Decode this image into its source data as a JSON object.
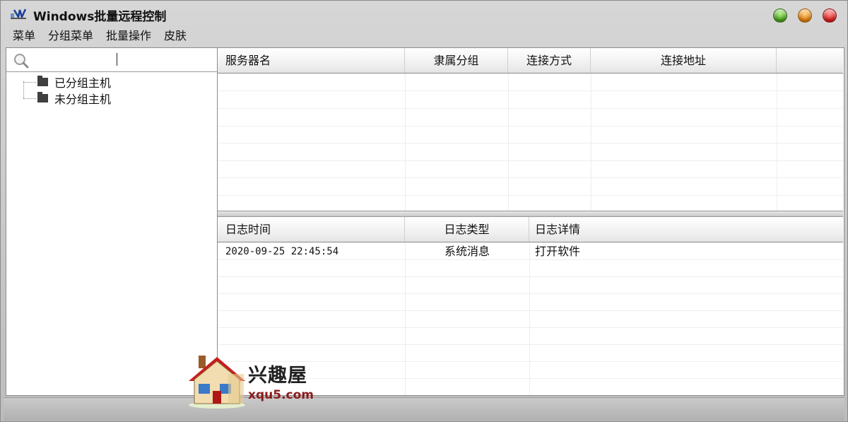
{
  "window": {
    "title": "Windows批量远程控制",
    "icon": "remote-desktop-app-icon",
    "controls": [
      "maximize-green-icon",
      "minimize-orange-icon",
      "close-red-icon"
    ]
  },
  "menu": {
    "items": [
      "菜单",
      "分组菜单",
      "批量操作",
      "皮肤"
    ]
  },
  "search": {
    "value": "",
    "icon": "search-icon"
  },
  "tree": {
    "nodes": [
      {
        "label": "已分组主机",
        "icon": "folder-icon"
      },
      {
        "label": "未分组主机",
        "icon": "folder-icon"
      }
    ]
  },
  "servers_table": {
    "columns": [
      "服务器名",
      "隶属分组",
      "连接方式",
      "连接地址"
    ],
    "rows": []
  },
  "log_table": {
    "columns": [
      "日志时间",
      "日志类型",
      "日志详情"
    ],
    "rows": [
      {
        "time": "2020-09-25 22:45:54",
        "type": "系统消息",
        "detail": "打开软件"
      }
    ]
  },
  "watermark": {
    "title": "兴趣屋",
    "url": "xqu5.com",
    "icon": "house-logo-icon"
  },
  "colors": {
    "window_bg": "#c8c8c8",
    "header_bg": "#f1f1f1",
    "grid_line": "#eeeeee",
    "watermark_url": "#8b1a1a"
  }
}
